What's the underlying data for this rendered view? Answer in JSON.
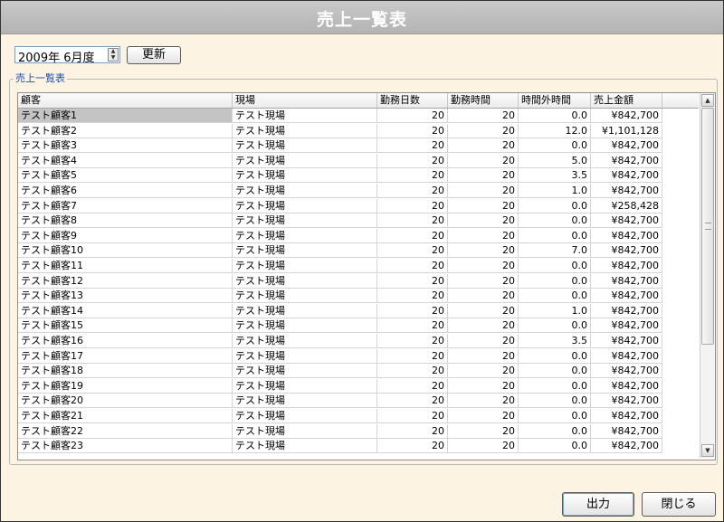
{
  "window": {
    "title": "売上一覧表"
  },
  "filter": {
    "month_value": "2009年 6月度",
    "update_label": "更新"
  },
  "group": {
    "label": "売上一覧表"
  },
  "table": {
    "columns": [
      "顧客",
      "現場",
      "勤務日数",
      "勤務時間",
      "時間外時間",
      "売上金額"
    ],
    "rows": [
      [
        "テスト顧客1",
        "テスト現場",
        "20",
        "20",
        "0.0",
        "¥842,700"
      ],
      [
        "テスト顧客2",
        "テスト現場",
        "20",
        "20",
        "12.0",
        "¥1,101,128"
      ],
      [
        "テスト顧客3",
        "テスト現場",
        "20",
        "20",
        "0.0",
        "¥842,700"
      ],
      [
        "テスト顧客4",
        "テスト現場",
        "20",
        "20",
        "5.0",
        "¥842,700"
      ],
      [
        "テスト顧客5",
        "テスト現場",
        "20",
        "20",
        "3.5",
        "¥842,700"
      ],
      [
        "テスト顧客6",
        "テスト現場",
        "20",
        "20",
        "1.0",
        "¥842,700"
      ],
      [
        "テスト顧客7",
        "テスト現場",
        "20",
        "20",
        "0.0",
        "¥258,428"
      ],
      [
        "テスト顧客8",
        "テスト現場",
        "20",
        "20",
        "0.0",
        "¥842,700"
      ],
      [
        "テスト顧客9",
        "テスト現場",
        "20",
        "20",
        "0.0",
        "¥842,700"
      ],
      [
        "テスト顧客10",
        "テスト現場",
        "20",
        "20",
        "7.0",
        "¥842,700"
      ],
      [
        "テスト顧客11",
        "テスト現場",
        "20",
        "20",
        "0.0",
        "¥842,700"
      ],
      [
        "テスト顧客12",
        "テスト現場",
        "20",
        "20",
        "0.0",
        "¥842,700"
      ],
      [
        "テスト顧客13",
        "テスト現場",
        "20",
        "20",
        "0.0",
        "¥842,700"
      ],
      [
        "テスト顧客14",
        "テスト現場",
        "20",
        "20",
        "1.0",
        "¥842,700"
      ],
      [
        "テスト顧客15",
        "テスト現場",
        "20",
        "20",
        "0.0",
        "¥842,700"
      ],
      [
        "テスト顧客16",
        "テスト現場",
        "20",
        "20",
        "3.5",
        "¥842,700"
      ],
      [
        "テスト顧客17",
        "テスト現場",
        "20",
        "20",
        "0.0",
        "¥842,700"
      ],
      [
        "テスト顧客18",
        "テスト現場",
        "20",
        "20",
        "0.0",
        "¥842,700"
      ],
      [
        "テスト顧客19",
        "テスト現場",
        "20",
        "20",
        "0.0",
        "¥842,700"
      ],
      [
        "テスト顧客20",
        "テスト現場",
        "20",
        "20",
        "0.0",
        "¥842,700"
      ],
      [
        "テスト顧客21",
        "テスト現場",
        "20",
        "20",
        "0.0",
        "¥842,700"
      ],
      [
        "テスト顧客22",
        "テスト現場",
        "20",
        "20",
        "0.0",
        "¥842,700"
      ],
      [
        "テスト顧客23",
        "テスト現場",
        "20",
        "20",
        "0.0",
        "¥842,700"
      ]
    ],
    "selected_row": 0
  },
  "buttons": {
    "output_label": "出力",
    "close_label": "閉じる"
  },
  "icons": {
    "spin_up": "spin-up-arrow-icon",
    "spin_down": "spin-down-arrow-icon",
    "scroll_up": "scroll-up-arrow-icon",
    "scroll_down": "scroll-down-arrow-icon"
  },
  "colors": {
    "background": "#fdf3e2",
    "title_bar": "#bdbdbd",
    "group_label": "#1b4fa8",
    "selected_row": "#c4c4c4"
  }
}
